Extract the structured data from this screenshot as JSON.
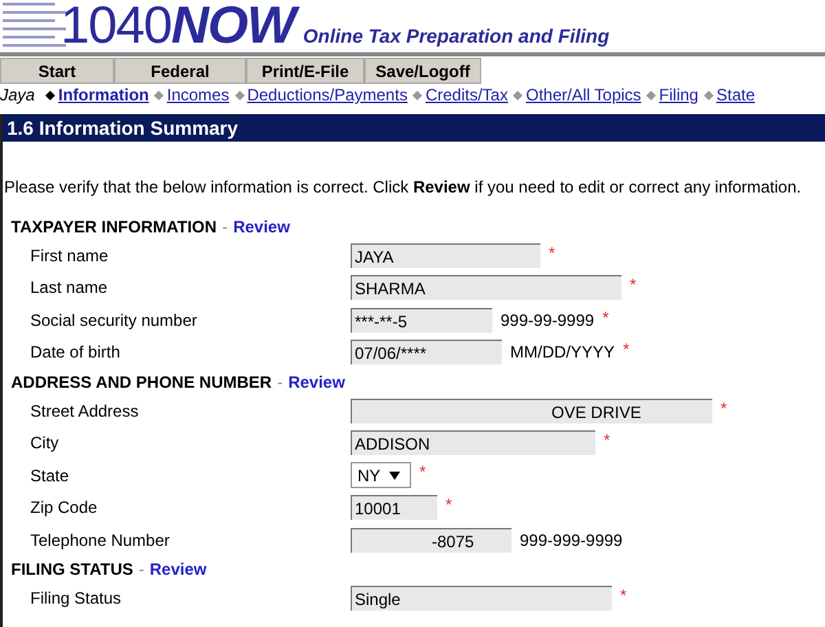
{
  "logo": {
    "number": "1040",
    "brand": "NOW",
    "tagline": "Online Tax Preparation and Filing"
  },
  "tabs": [
    {
      "label": "Start"
    },
    {
      "label": "Federal"
    },
    {
      "label": "Print/E-File"
    },
    {
      "label": "Save/Logoff"
    }
  ],
  "breadcrumb": {
    "user": "Jaya",
    "links": [
      {
        "label": "Information",
        "selected": true
      },
      {
        "label": "Incomes",
        "selected": false
      },
      {
        "label": "Deductions/Payments",
        "selected": false
      },
      {
        "label": "Credits/Tax",
        "selected": false
      },
      {
        "label": "Other/All Topics",
        "selected": false
      },
      {
        "label": "Filing",
        "selected": false
      },
      {
        "label": "State",
        "selected": false
      }
    ]
  },
  "page_title": "1.6 Information Summary",
  "intro": "Please verify that the below information is correct. Click **Review** if you need to edit or correct any information.",
  "sections": [
    {
      "title": "TAXPAYER INFORMATION",
      "separator": "-",
      "link": "Review",
      "fields": [
        {
          "label": "First name",
          "kind": "input",
          "value": "JAYA",
          "mark": "*"
        },
        {
          "label": "Last name",
          "kind": "input",
          "value": "SHARMA",
          "mark": "*"
        },
        {
          "label": "Social security number",
          "kind": "input",
          "value": "***-**-5",
          "hint": "999-99-9999",
          "mark": "*"
        },
        {
          "label": "Date of birth",
          "kind": "input",
          "value": "07/06/****",
          "hint": "MM/DD/YYYY",
          "mark": "*"
        }
      ]
    },
    {
      "title": "ADDRESS AND PHONE NUMBER",
      "separator": "-",
      "link": "Review",
      "fields": [
        {
          "label": "Street Address",
          "kind": "input",
          "value": "OVE DRIVE",
          "mark": "*"
        },
        {
          "label": "City",
          "kind": "input",
          "value": "ADDISON",
          "mark": "*"
        },
        {
          "label": "State",
          "kind": "select",
          "value": "NY",
          "mark": "*"
        },
        {
          "label": "Zip Code",
          "kind": "input",
          "value": "10001",
          "mark": "*"
        },
        {
          "label": "Telephone Number",
          "kind": "input",
          "value": "-8075",
          "hint": "999-999-9999"
        }
      ]
    },
    {
      "title": "FILING STATUS",
      "separator": "-",
      "link": "Review",
      "fields": [
        {
          "label": "Filing Status",
          "kind": "input",
          "value": "Single",
          "mark": "*"
        }
      ]
    }
  ]
}
